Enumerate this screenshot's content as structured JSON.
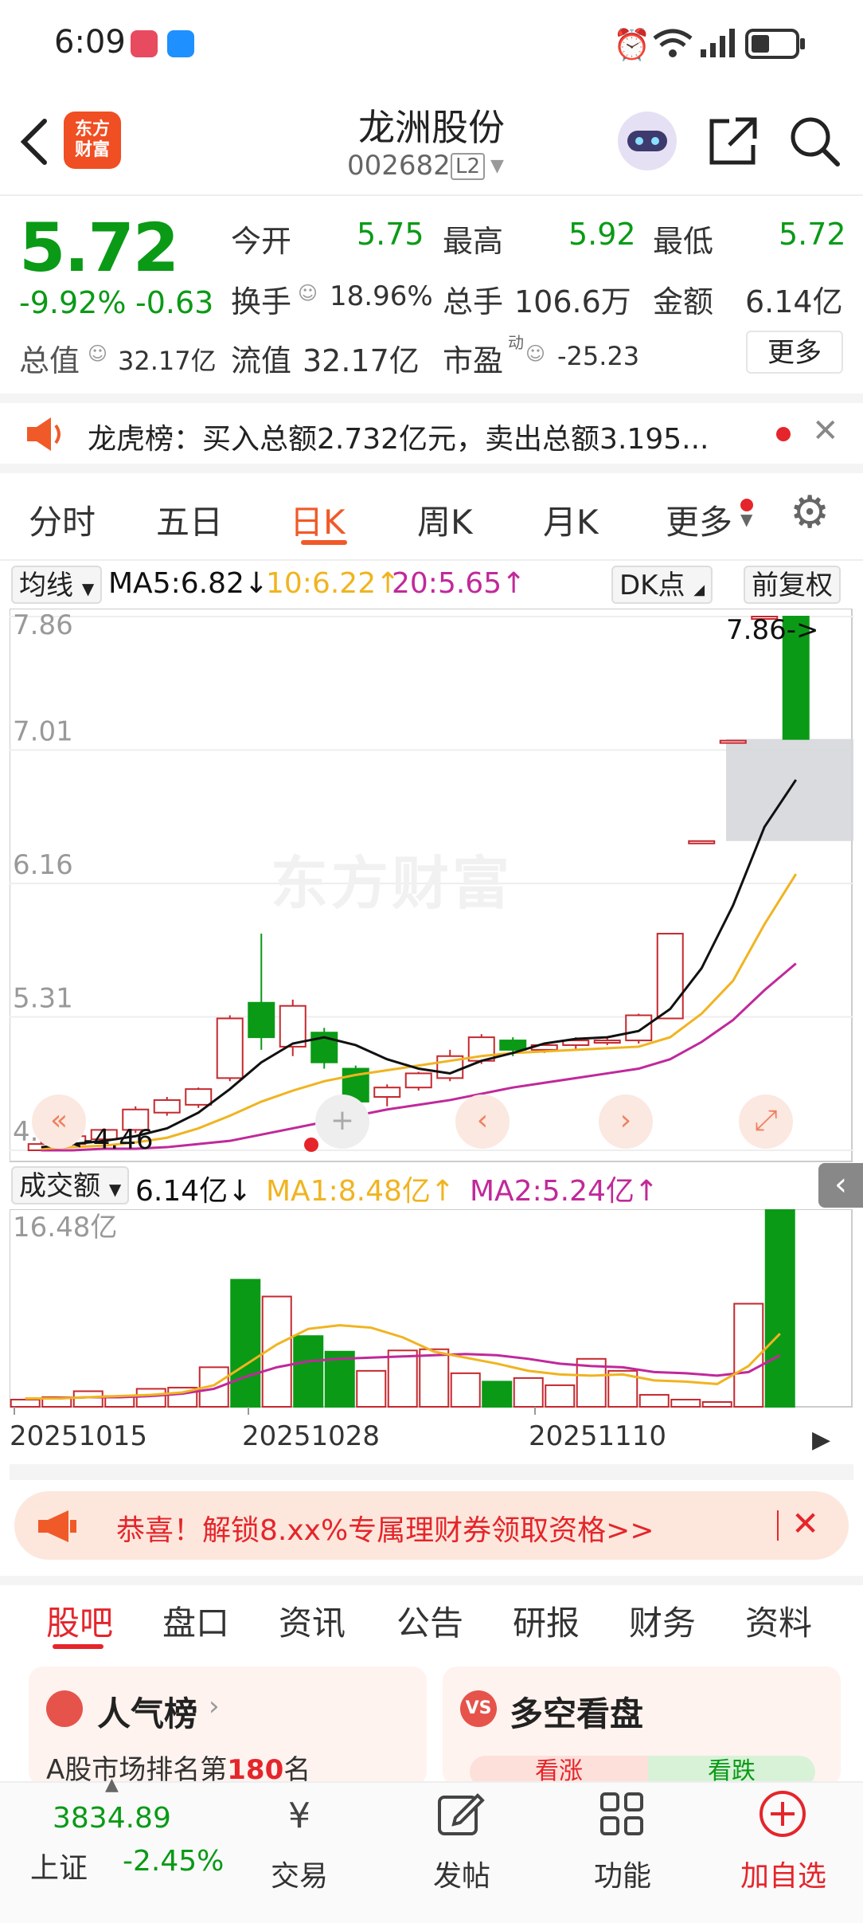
{
  "status_bar": {
    "time": "6:09"
  },
  "header": {
    "logo_text": "东方\n财富",
    "stock_name": "龙洲股份",
    "stock_code": "002682",
    "level": "L2"
  },
  "quote": {
    "price": "5.72",
    "change_pct": "-9.92%",
    "change": "-0.63",
    "open_label": "今开",
    "open": "5.75",
    "high_label": "最高",
    "high": "5.92",
    "low_label": "最低",
    "low": "5.72",
    "turnover_label": "换手",
    "turnover": "18.96%",
    "volume_label": "总手",
    "volume": "106.6万",
    "amount_label": "金额",
    "amount": "6.14亿",
    "mktcap_label": "总值",
    "mktcap": "32.17亿",
    "float_label": "流值",
    "float_cap": "32.17亿",
    "pe_label": "市盈",
    "pe_sup": "动",
    "pe": "-25.23",
    "more_button": "更多"
  },
  "notice": {
    "text": "龙虎榜：买入总额2.732亿元，卖出总额3.195..."
  },
  "chart_tabs": [
    "分时",
    "五日",
    "日K",
    "周K",
    "月K",
    "更多"
  ],
  "active_chart_tab": "日K",
  "kline_header": {
    "ma_select": "均线",
    "ma5": "MA5:6.82↓",
    "ma10": "10:6.22↑",
    "ma20": "20:5.65↑",
    "dk_button": "DK点",
    "adjust_button": "前复权"
  },
  "volume_header": {
    "select": "成交额",
    "value": "6.14亿↓",
    "ma1": "MA1:8.48亿↑",
    "ma2": "MA2:5.24亿↑"
  },
  "chart_data": {
    "type": "candlestick",
    "y_axis_labels": [
      "7.86",
      "7.01",
      "6.16",
      "5.31",
      "4.46"
    ],
    "annotations": {
      "high": "7.86->",
      "low": "<-4.46"
    },
    "candles": [
      {
        "o": 4.46,
        "c": 4.5,
        "h": 4.52,
        "l": 4.46
      },
      {
        "o": 4.5,
        "c": 4.55,
        "h": 4.56,
        "l": 4.49
      },
      {
        "o": 4.53,
        "c": 4.59,
        "h": 4.6,
        "l": 4.52
      },
      {
        "o": 4.59,
        "c": 4.72,
        "h": 4.74,
        "l": 4.57
      },
      {
        "o": 4.7,
        "c": 4.78,
        "h": 4.8,
        "l": 4.68
      },
      {
        "o": 4.75,
        "c": 4.85,
        "h": 4.86,
        "l": 4.73
      },
      {
        "o": 4.92,
        "c": 5.3,
        "h": 5.32,
        "l": 4.9
      },
      {
        "o": 5.4,
        "c": 5.18,
        "h": 5.84,
        "l": 5.1
      },
      {
        "o": 5.12,
        "c": 5.38,
        "h": 5.42,
        "l": 5.06
      },
      {
        "o": 5.21,
        "c": 5.02,
        "h": 5.24,
        "l": 4.98
      },
      {
        "o": 4.98,
        "c": 4.77,
        "h": 5.0,
        "l": 4.74
      },
      {
        "o": 4.8,
        "c": 4.86,
        "h": 4.88,
        "l": 4.74
      },
      {
        "o": 4.86,
        "c": 4.95,
        "h": 4.96,
        "l": 4.84
      },
      {
        "o": 4.92,
        "c": 5.06,
        "h": 5.1,
        "l": 4.9
      },
      {
        "o": 5.03,
        "c": 5.18,
        "h": 5.2,
        "l": 5.01
      },
      {
        "o": 5.16,
        "c": 5.1,
        "h": 5.18,
        "l": 5.06
      },
      {
        "o": 5.1,
        "c": 5.13,
        "h": 5.14,
        "l": 5.08
      },
      {
        "o": 5.13,
        "c": 5.16,
        "h": 5.18,
        "l": 5.1
      },
      {
        "o": 5.15,
        "c": 5.16,
        "h": 5.18,
        "l": 5.13
      },
      {
        "o": 5.16,
        "c": 5.32,
        "h": 5.33,
        "l": 5.14
      },
      {
        "o": 5.3,
        "c": 5.84,
        "h": 5.84,
        "l": 5.3
      },
      {
        "o": 6.43,
        "c": 6.43,
        "h": 6.43,
        "l": 6.43
      },
      {
        "o": 7.07,
        "c": 7.07,
        "h": 7.07,
        "l": 7.07
      },
      {
        "o": 7.86,
        "c": 7.86,
        "h": 7.86,
        "l": 7.86
      },
      {
        "o": 7.86,
        "c": 7.08,
        "h": 7.86,
        "l": 7.08
      }
    ],
    "ma5": [
      4.48,
      4.5,
      4.52,
      4.55,
      4.6,
      4.7,
      4.85,
      5.02,
      5.14,
      5.18,
      5.13,
      5.04,
      4.98,
      4.95,
      5.03,
      5.08,
      5.14,
      5.17,
      5.18,
      5.22,
      5.36,
      5.62,
      6.02,
      6.52,
      6.82
    ],
    "ma10": [
      4.47,
      4.48,
      4.49,
      4.51,
      4.54,
      4.6,
      4.68,
      4.77,
      4.84,
      4.9,
      4.94,
      4.97,
      5.0,
      5.03,
      5.06,
      5.08,
      5.09,
      5.1,
      5.11,
      5.12,
      5.18,
      5.33,
      5.54,
      5.9,
      6.22
    ],
    "ma20": [
      4.46,
      4.46,
      4.47,
      4.47,
      4.48,
      4.5,
      4.52,
      4.56,
      4.6,
      4.64,
      4.68,
      4.72,
      4.75,
      4.78,
      4.82,
      4.86,
      4.89,
      4.92,
      4.95,
      4.98,
      5.04,
      5.15,
      5.29,
      5.48,
      5.65
    ],
    "volume_max_label": "16.48亿",
    "volume": [
      0.6,
      0.8,
      1.3,
      0.9,
      1.5,
      1.6,
      3.3,
      10.6,
      9.2,
      5.9,
      4.6,
      3.0,
      4.7,
      4.8,
      2.8,
      2.1,
      2.4,
      1.8,
      4.0,
      3.0,
      1.0,
      0.6,
      0.4,
      8.6,
      16.48
    ],
    "vol_ma1": [
      0.7,
      0.7,
      0.8,
      0.9,
      1.0,
      1.2,
      1.8,
      3.5,
      5.2,
      6.5,
      6.8,
      6.6,
      5.8,
      4.6,
      4.1,
      3.6,
      3.0,
      2.7,
      2.6,
      2.7,
      2.2,
      2.1,
      1.9,
      3.4,
      6.1
    ],
    "vol_ma2": [
      0.7,
      0.7,
      0.8,
      0.8,
      0.9,
      1.1,
      1.5,
      2.5,
      3.3,
      3.8,
      4.0,
      4.1,
      4.2,
      4.3,
      4.4,
      4.3,
      4.0,
      3.6,
      3.4,
      3.3,
      2.9,
      2.8,
      2.6,
      2.9,
      4.3
    ],
    "x_axis_labels": [
      "20251015",
      "20251028",
      "20251110"
    ]
  },
  "promo_banner": {
    "text": "恭喜！解锁8.xx%专属理财券领取资格>>"
  },
  "bottom_tabs": [
    "股吧",
    "盘口",
    "资讯",
    "公告",
    "研报",
    "财务",
    "资料"
  ],
  "cards": {
    "left_title": "人气榜",
    "left_sub": "A股市场排名第",
    "left_rank": "180",
    "left_sub2": "名",
    "right_title": "多空看盘",
    "bull": "看涨",
    "bear": "看跌"
  },
  "index": {
    "value": "3834.89",
    "name": "上证",
    "change": "-2.45%"
  },
  "bottom_bar": [
    "交易",
    "发帖",
    "功能",
    "加自选"
  ],
  "watermark": "东方财富"
}
